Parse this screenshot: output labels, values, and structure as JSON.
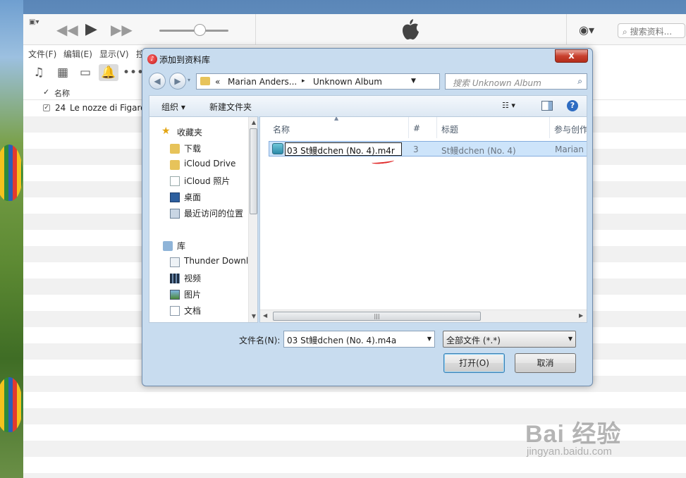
{
  "itunes": {
    "menu": [
      "文件(F)",
      "编辑(E)",
      "显示(V)",
      "控"
    ],
    "search_placeholder": "搜索资料...",
    "column_name": "名称",
    "track": {
      "number": "24",
      "title": "Le nozze di Figaro"
    }
  },
  "dialog": {
    "title": "添加到资料库",
    "close_label": "x",
    "breadcrumb": {
      "prefix": "«",
      "part1": "Marian Anders...",
      "sep": "▸",
      "part2": "Unknown Album"
    },
    "search_placeholder": "搜索 Unknown Album",
    "toolbar": {
      "organize": "组织 ▾",
      "new_folder": "新建文件夹",
      "help": "?"
    },
    "nav": {
      "favorites": "收藏夹",
      "favorites_items": [
        "下载",
        "iCloud Drive",
        "iCloud 照片",
        "桌面",
        "最近访问的位置"
      ],
      "library": "库",
      "library_items": [
        "Thunder Downl",
        "视频",
        "图片",
        "文档"
      ]
    },
    "columns": {
      "name": "名称",
      "number": "#",
      "title": "标题",
      "contributing": "参与创作"
    },
    "file": {
      "rename_value": "03 St鳗dchen (No. 4).m4r",
      "number": "3",
      "title": "St鳗dchen (No. 4)",
      "artist": "Marian A"
    },
    "filename_label": "文件名(N):",
    "filename_value": "03 St鳗dchen (No. 4).m4a",
    "filetype_value": "全部文件 (*.*)",
    "open_button": "打开(O)",
    "cancel_button": "取消"
  },
  "watermark": {
    "brand": "Bai 经验",
    "url": "jingyan.baidu.com"
  }
}
